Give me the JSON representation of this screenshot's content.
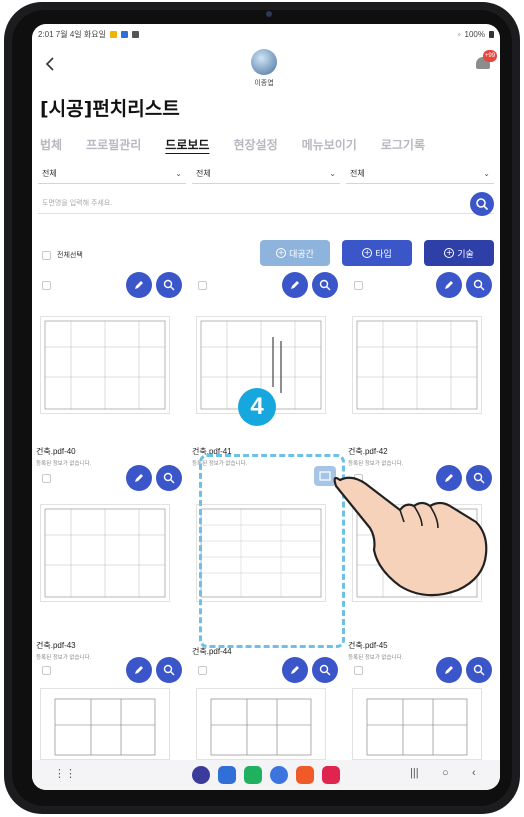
{
  "status": {
    "time_date": "2:01  7월 4일 화요일",
    "battery": "100%"
  },
  "header": {
    "user_name": "이종엽",
    "notif_badge": "+99"
  },
  "page_title": "[시공]펀치리스트",
  "tabs": [
    "법체",
    "프로필관리",
    "드로보드",
    "현장설정",
    "메뉴보이기",
    "로그기록"
  ],
  "active_tab": 2,
  "filters": [
    "전체",
    "전체",
    "전체"
  ],
  "search": {
    "placeholder": "도면명을 입력해 주세요."
  },
  "select_all_label": "전체선택",
  "actions": {
    "space": "대공간",
    "type": "타입",
    "tech": "기술"
  },
  "colors": {
    "primary": "#3b56c9",
    "pale": "#8eb3dc",
    "highlight": "#17a7df"
  },
  "cards": [
    {
      "name": "건축.pdf-40",
      "sub": "등록된 정보가 없습니다."
    },
    {
      "name": "건축.pdf-41",
      "sub": "등록된 정보가 없습니다."
    },
    {
      "name": "건축.pdf-42",
      "sub": "등록된 정보가 없습니다."
    },
    {
      "name": "건축.pdf-43",
      "sub": "등록된 정보가 없습니다."
    },
    {
      "name": "건축.pdf-44",
      "sub": ""
    },
    {
      "name": "건축.pdf-45",
      "sub": "등록된 정보가 없습니다."
    }
  ],
  "step_number": "4"
}
